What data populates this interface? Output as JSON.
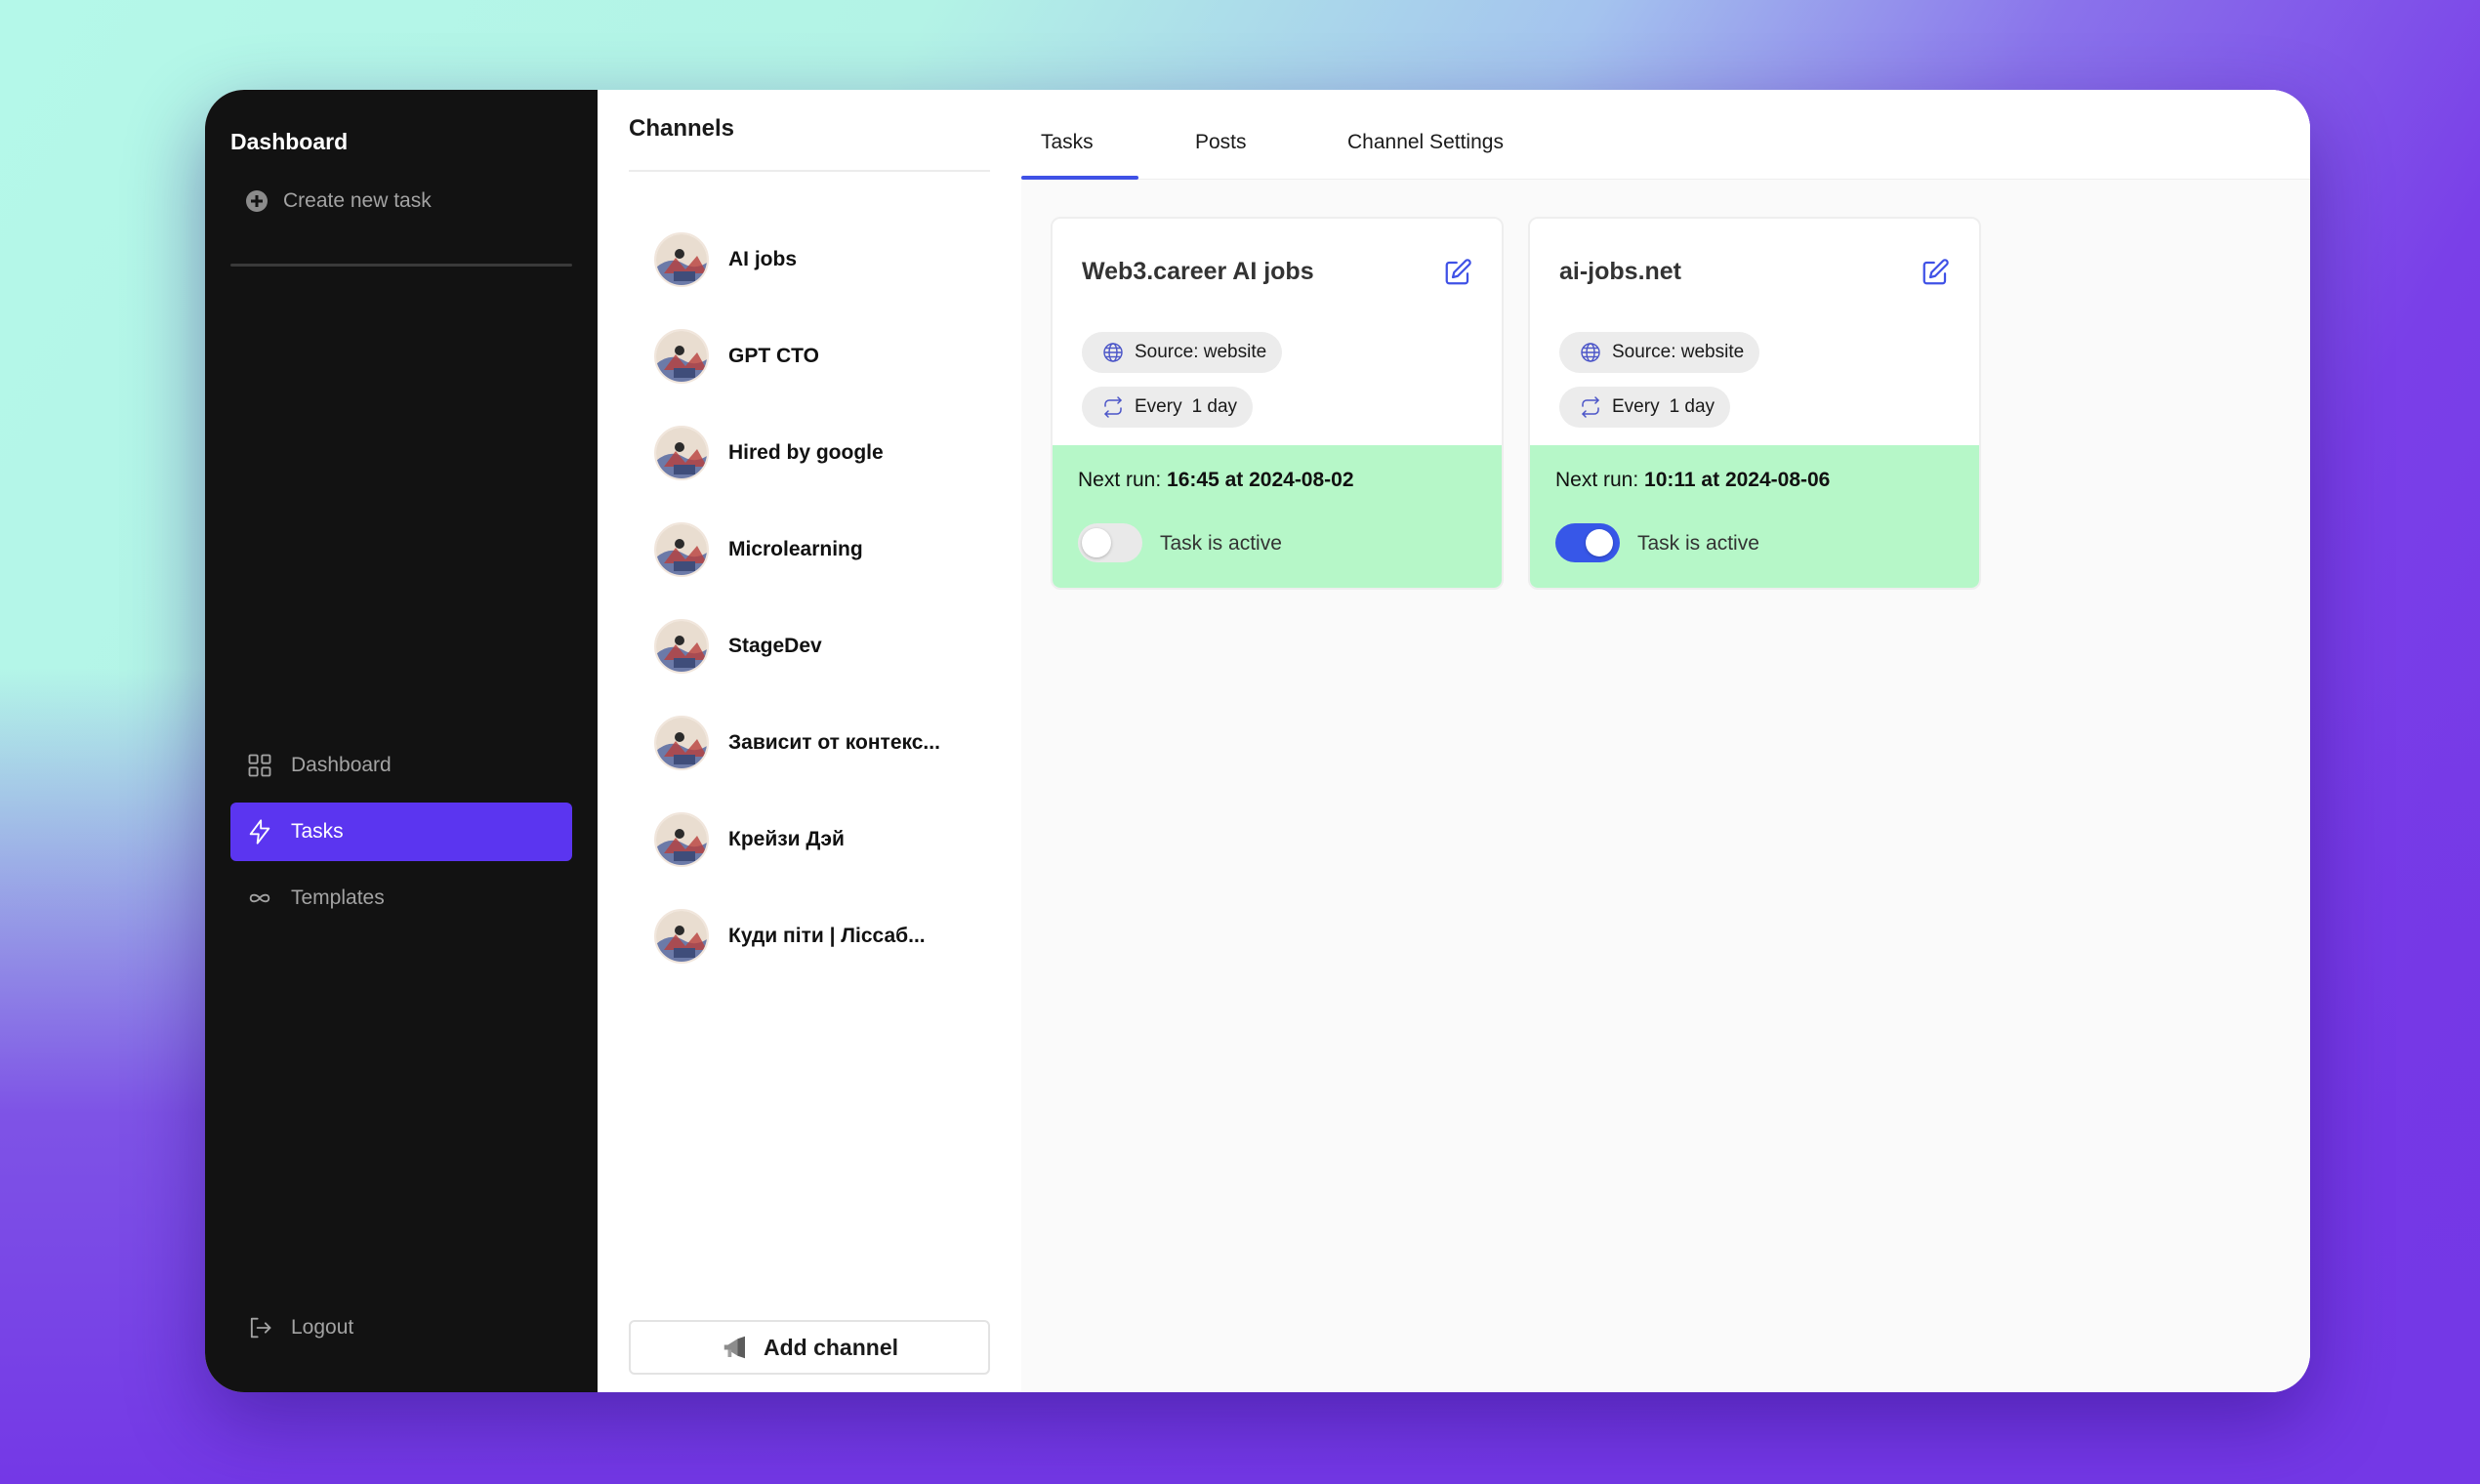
{
  "sidebar": {
    "title": "Dashboard",
    "create_label": "Create new task",
    "nav": [
      {
        "label": "Dashboard",
        "icon": "grid-icon",
        "active": false
      },
      {
        "label": "Tasks",
        "icon": "bolt-icon",
        "active": true
      },
      {
        "label": "Templates",
        "icon": "infinity-icon",
        "active": false
      }
    ],
    "logout_label": "Logout"
  },
  "channels": {
    "title": "Channels",
    "items": [
      {
        "name": "AI jobs"
      },
      {
        "name": "GPT CTO"
      },
      {
        "name": "Hired by google"
      },
      {
        "name": "Microlearning"
      },
      {
        "name": "StageDev"
      },
      {
        "name": "Зависит от контекс..."
      },
      {
        "name": "Крейзи Дэй"
      },
      {
        "name": "Куди піти | Ліссаб..."
      }
    ],
    "add_label": "Add channel"
  },
  "tabs": [
    {
      "label": "Tasks",
      "active": true
    },
    {
      "label": "Posts",
      "active": false
    },
    {
      "label": "Channel Settings",
      "active": false
    }
  ],
  "tasks": [
    {
      "title": "Web3.career AI jobs",
      "source": "Source: website",
      "every": "Every",
      "interval": "1 day",
      "next_run_label": "Next run:",
      "next_run_value": "16:45 at 2024-08-02",
      "active_label": "Task is active",
      "active": false
    },
    {
      "title": "ai-jobs.net",
      "source": "Source: website",
      "every": "Every",
      "interval": "1 day",
      "next_run_label": "Next run:",
      "next_run_value": "10:11 at 2024-08-06",
      "active_label": "Task is active",
      "active": true
    }
  ],
  "colors": {
    "accent": "#5b35f0",
    "toggle_on": "#3757e8",
    "card_status_bg": "#b6f7c8",
    "sidebar_bg": "#121212"
  }
}
